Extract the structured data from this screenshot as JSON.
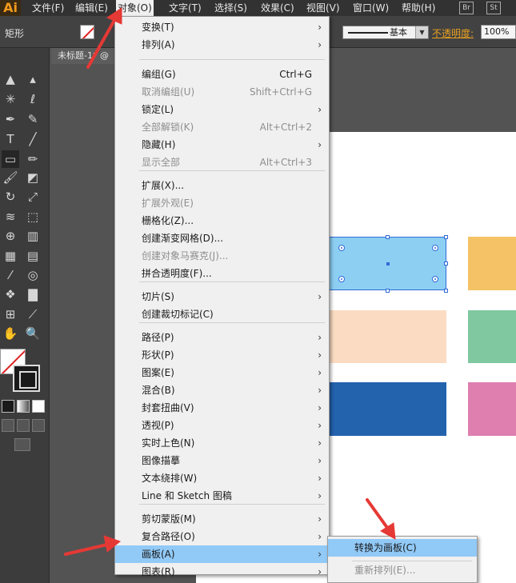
{
  "app": {
    "logo": "Ai"
  },
  "menubar": {
    "items": [
      {
        "label": "文件(F)"
      },
      {
        "label": "编辑(E)"
      },
      {
        "label": "对象(O)"
      },
      {
        "label": "文字(T)"
      },
      {
        "label": "选择(S)"
      },
      {
        "label": "效果(C)"
      },
      {
        "label": "视图(V)"
      },
      {
        "label": "窗口(W)"
      },
      {
        "label": "帮助(H)"
      }
    ],
    "bridge": "Br",
    "stock": "St"
  },
  "controlbar": {
    "shape_label": "矩形",
    "stroke_style": "基本",
    "opacity_label": "不透明度:",
    "opacity_value": "100%"
  },
  "document": {
    "tab_title": "未标题-1* @"
  },
  "colors": {
    "accent_orange": "#f29a1c",
    "highlight_blue": "#91c9f7",
    "selection_blue": "#2f6ad6",
    "arrow_red": "#e53935"
  },
  "artboard": {
    "shapes": [
      {
        "name": "selected-light-blue-rect",
        "color": "#8ccff3"
      },
      {
        "name": "yellow-rect",
        "color": "#f5c365"
      },
      {
        "name": "peach-rect",
        "color": "#fbdcc2"
      },
      {
        "name": "green-rect",
        "color": "#7fc8a0"
      },
      {
        "name": "dark-blue-rect",
        "color": "#2362ad"
      },
      {
        "name": "pink-rect",
        "color": "#de7fb0"
      }
    ]
  },
  "object_menu": {
    "items": [
      {
        "label": "变换(T)",
        "shortcut": "",
        "submenu": "›"
      },
      {
        "label": "排列(A)",
        "shortcut": "",
        "submenu": "›"
      },
      {
        "label": "编组(G)",
        "shortcut": "Ctrl+G",
        "submenu": ""
      },
      {
        "label": "取消编组(U)",
        "shortcut": "Shift+Ctrl+G",
        "submenu": ""
      },
      {
        "label": "锁定(L)",
        "shortcut": "",
        "submenu": "›"
      },
      {
        "label": "全部解锁(K)",
        "shortcut": "Alt+Ctrl+2",
        "submenu": ""
      },
      {
        "label": "隐藏(H)",
        "shortcut": "",
        "submenu": "›"
      },
      {
        "label": "显示全部",
        "shortcut": "Alt+Ctrl+3",
        "submenu": ""
      },
      {
        "label": "扩展(X)...",
        "shortcut": "",
        "submenu": ""
      },
      {
        "label": "扩展外观(E)",
        "shortcut": "",
        "submenu": ""
      },
      {
        "label": "栅格化(Z)...",
        "shortcut": "",
        "submenu": ""
      },
      {
        "label": "创建渐变网格(D)...",
        "shortcut": "",
        "submenu": ""
      },
      {
        "label": "创建对象马赛克(J)...",
        "shortcut": "",
        "submenu": ""
      },
      {
        "label": "拼合透明度(F)...",
        "shortcut": "",
        "submenu": ""
      },
      {
        "label": "切片(S)",
        "shortcut": "",
        "submenu": "›"
      },
      {
        "label": "创建裁切标记(C)",
        "shortcut": "",
        "submenu": ""
      },
      {
        "label": "路径(P)",
        "shortcut": "",
        "submenu": "›"
      },
      {
        "label": "形状(P)",
        "shortcut": "",
        "submenu": "›"
      },
      {
        "label": "图案(E)",
        "shortcut": "",
        "submenu": "›"
      },
      {
        "label": "混合(B)",
        "shortcut": "",
        "submenu": "›"
      },
      {
        "label": "封套扭曲(V)",
        "shortcut": "",
        "submenu": "›"
      },
      {
        "label": "透视(P)",
        "shortcut": "",
        "submenu": "›"
      },
      {
        "label": "实时上色(N)",
        "shortcut": "",
        "submenu": "›"
      },
      {
        "label": "图像描摹",
        "shortcut": "",
        "submenu": "›"
      },
      {
        "label": "文本绕排(W)",
        "shortcut": "",
        "submenu": "›"
      },
      {
        "label": "Line 和 Sketch 图稿",
        "shortcut": "",
        "submenu": "›"
      },
      {
        "label": "剪切蒙版(M)",
        "shortcut": "",
        "submenu": "›"
      },
      {
        "label": "复合路径(O)",
        "shortcut": "",
        "submenu": "›"
      },
      {
        "label": "画板(A)",
        "shortcut": "",
        "submenu": "›"
      },
      {
        "label": "图表(R)",
        "shortcut": "",
        "submenu": "›"
      }
    ]
  },
  "artboard_submenu": {
    "items": [
      {
        "label": "转换为画板(C)"
      },
      {
        "label": "重新排列(E)..."
      }
    ]
  },
  "toolbox": {
    "tools": [
      {
        "name": "selection-tool-icon",
        "glyph": "▲"
      },
      {
        "name": "direct-selection-tool-icon",
        "glyph": "▴"
      },
      {
        "name": "magic-wand-tool-icon",
        "glyph": "✳"
      },
      {
        "name": "lasso-tool-icon",
        "glyph": "ℓ"
      },
      {
        "name": "pen-tool-icon",
        "glyph": "✒"
      },
      {
        "name": "curvature-tool-icon",
        "glyph": "✎"
      },
      {
        "name": "type-tool-icon",
        "glyph": "T"
      },
      {
        "name": "line-segment-tool-icon",
        "glyph": "╱"
      },
      {
        "name": "rectangle-tool-icon",
        "glyph": "▭"
      },
      {
        "name": "pencil-tool-icon",
        "glyph": "✏"
      },
      {
        "name": "paintbrush-tool-icon",
        "glyph": "🖌"
      },
      {
        "name": "eraser-tool-icon",
        "glyph": "◩"
      },
      {
        "name": "rotate-tool-icon",
        "glyph": "↻"
      },
      {
        "name": "scale-tool-icon",
        "glyph": "⤢"
      },
      {
        "name": "width-tool-icon",
        "glyph": "≋"
      },
      {
        "name": "free-transform-tool-icon",
        "glyph": "⬚"
      },
      {
        "name": "shape-builder-tool-icon",
        "glyph": "⊕"
      },
      {
        "name": "graph-tool-icon",
        "glyph": "▥"
      },
      {
        "name": "mesh-tool-icon",
        "glyph": "▦"
      },
      {
        "name": "gradient-tool-icon",
        "glyph": "▤"
      },
      {
        "name": "eyedropper-tool-icon",
        "glyph": "⁄"
      },
      {
        "name": "blend-tool-icon",
        "glyph": "◎"
      },
      {
        "name": "symbol-sprayer-tool-icon",
        "glyph": "❖"
      },
      {
        "name": "column-graph-tool-icon",
        "glyph": "▇"
      },
      {
        "name": "artboard-tool-icon",
        "glyph": "⊞"
      },
      {
        "name": "slice-tool-icon",
        "glyph": "⟋"
      },
      {
        "name": "hand-tool-icon",
        "glyph": "✋"
      },
      {
        "name": "zoom-tool-icon",
        "glyph": "🔍"
      }
    ]
  }
}
